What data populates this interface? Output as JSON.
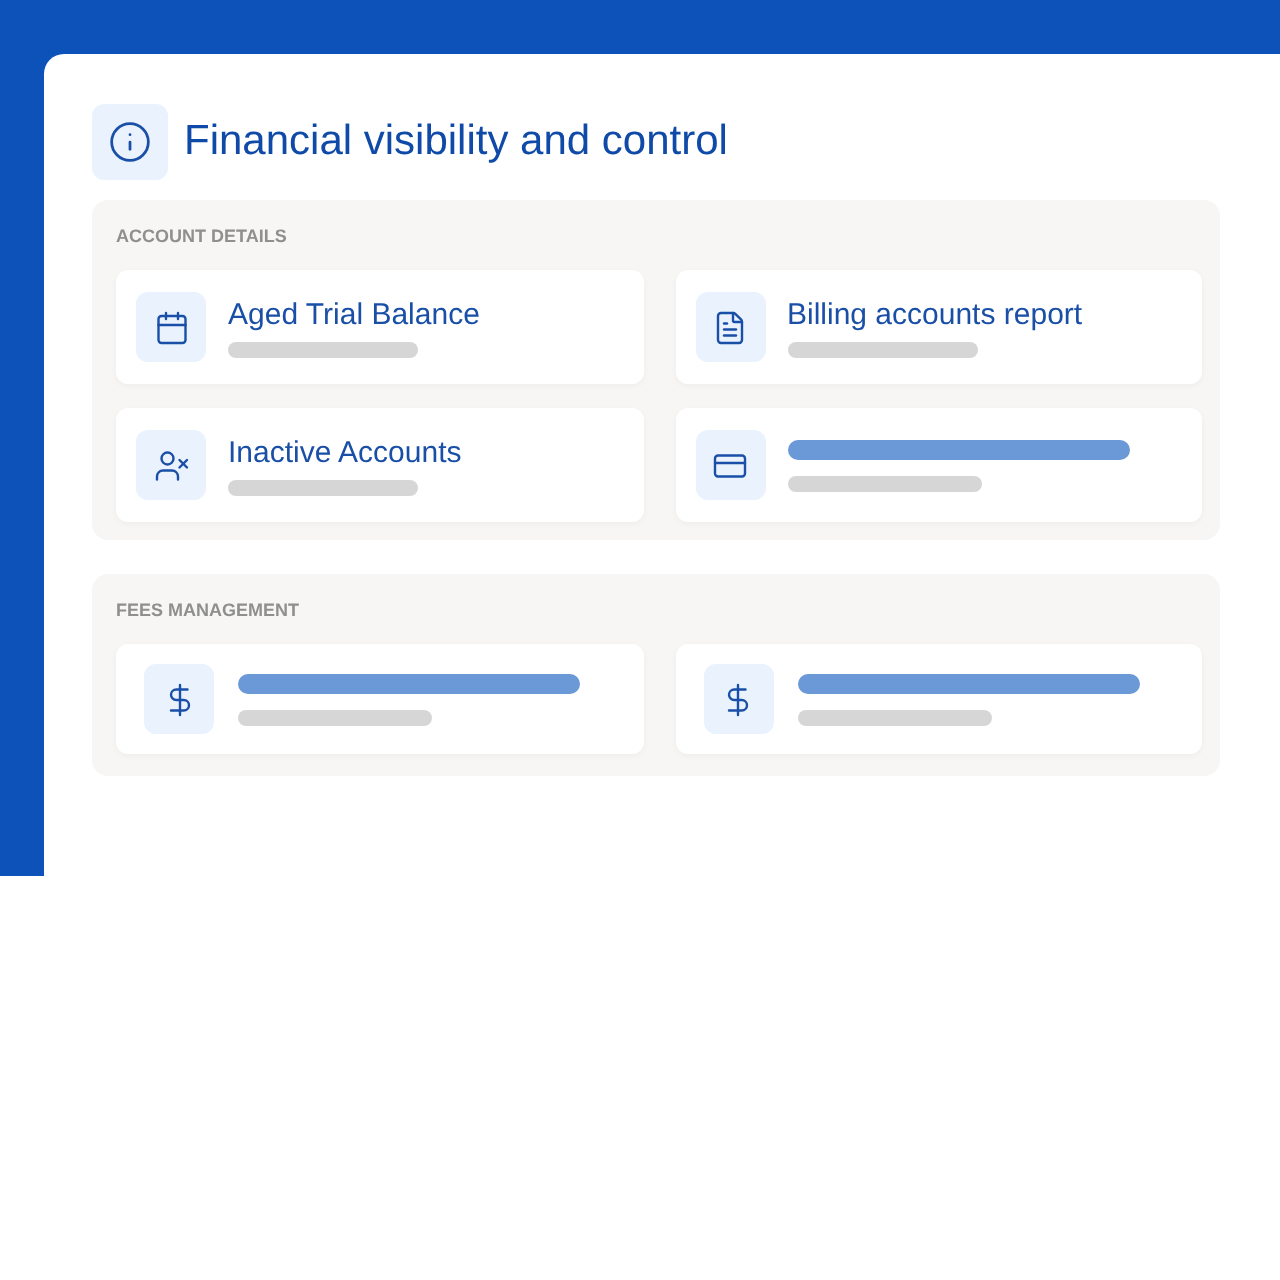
{
  "header": {
    "title": "Financial visibility and control"
  },
  "sections": [
    {
      "label": "ACCOUNT DETAILS",
      "items": [
        {
          "kind": "titled",
          "title": "Aged Trial Balance"
        },
        {
          "kind": "titled",
          "title": "Billing accounts report"
        },
        {
          "kind": "titled",
          "title": "Inactive Accounts"
        },
        {
          "kind": "skeleton"
        }
      ]
    },
    {
      "label": "FEES MANAGEMENT",
      "items": [
        {
          "kind": "skeleton"
        },
        {
          "kind": "skeleton"
        }
      ]
    }
  ]
}
